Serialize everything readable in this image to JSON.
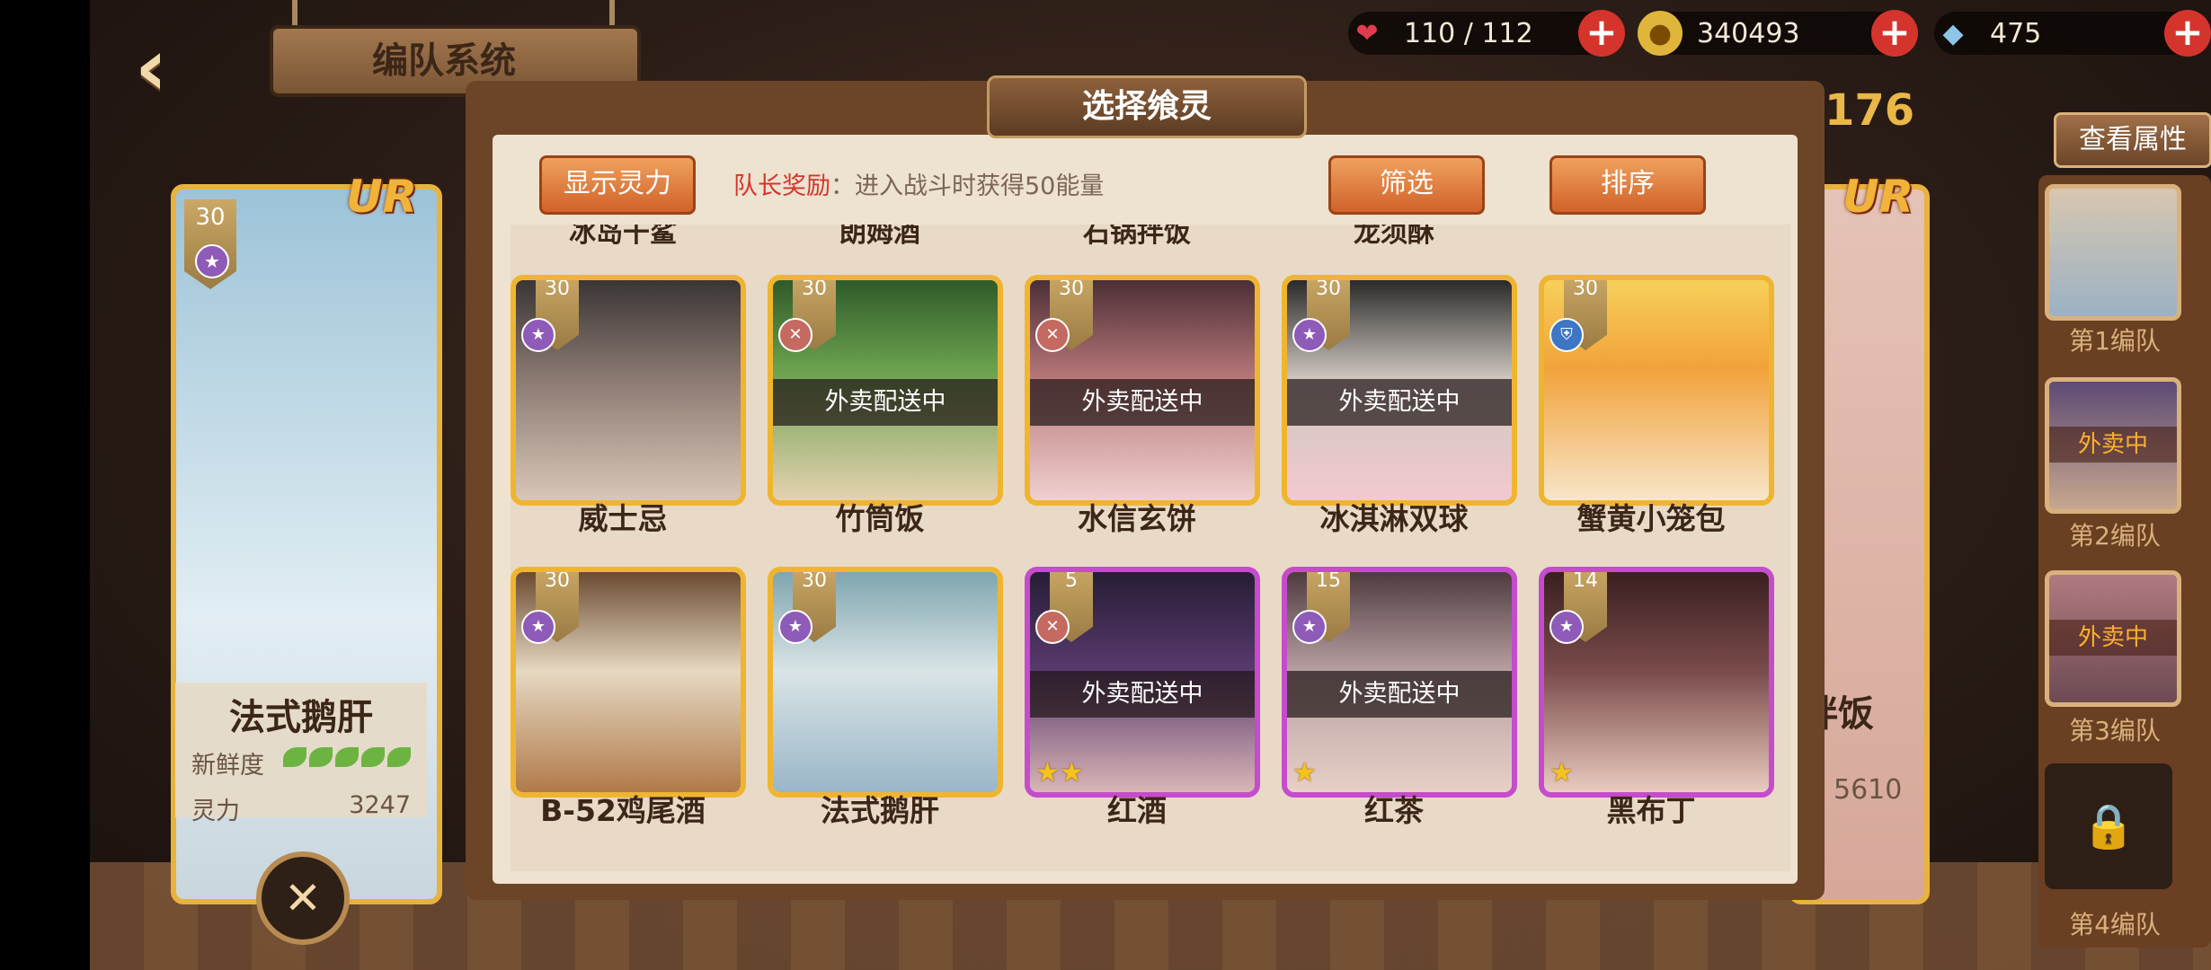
{
  "header": {
    "title": "编队系统",
    "back_icon": "back-arrow-icon"
  },
  "resources": [
    {
      "icon": "heart-icon",
      "value": "110 / 112",
      "color": "#e03c4f"
    },
    {
      "icon": "gold-coin-icon",
      "value": "340493",
      "color": "#e0b53b"
    },
    {
      "icon": "crystal-icon",
      "value": "475",
      "color": "#8ec6e8"
    }
  ],
  "left_character": {
    "rarity": "UR",
    "level": "30",
    "name": "法式鹅肝",
    "freshness_label": "新鲜度",
    "power_label": "灵力",
    "power_value": "3247"
  },
  "right_character": {
    "rarity": "UR",
    "name": "拌饭",
    "power_value": "5610",
    "power_total": "176"
  },
  "right_panel": {
    "attr_button": "查看属性",
    "teams": [
      {
        "label": "第1编队",
        "status": ""
      },
      {
        "label": "第2编队",
        "status": "外卖中"
      },
      {
        "label": "第3编队",
        "status": "外卖中"
      },
      {
        "label": "第4编队",
        "status": ""
      }
    ]
  },
  "modal": {
    "title": "选择飨灵",
    "show_power_button": "显示灵力",
    "leader_key": "队长奖励",
    "leader_text": "进入战斗时获得50能量",
    "filter_button": "筛选",
    "sort_button": "排序",
    "top_row_names": [
      "冰岛干鲨",
      "朗姆酒",
      "石锅拌饭",
      "龙须酥"
    ],
    "cards": [
      {
        "name": "威士忌",
        "level": "30",
        "status": "",
        "stars": ""
      },
      {
        "name": "竹筒饭",
        "level": "30",
        "status": "外卖配送中",
        "stars": ""
      },
      {
        "name": "水信玄饼",
        "level": "30",
        "status": "外卖配送中",
        "stars": ""
      },
      {
        "name": "冰淇淋双球",
        "level": "30",
        "status": "外卖配送中",
        "stars": ""
      },
      {
        "name": "蟹黄小笼包",
        "level": "30",
        "status": "",
        "stars": ""
      },
      {
        "name": "B-52鸡尾酒",
        "level": "30",
        "status": "",
        "stars": ""
      },
      {
        "name": "法式鹅肝",
        "level": "30",
        "status": "",
        "stars": ""
      },
      {
        "name": "红酒",
        "level": "5",
        "status": "外卖配送中",
        "stars": "★★"
      },
      {
        "name": "红茶",
        "level": "15",
        "status": "外卖配送中",
        "stars": "★"
      },
      {
        "name": "黑布丁",
        "level": "14",
        "status": "",
        "stars": "★"
      }
    ]
  }
}
